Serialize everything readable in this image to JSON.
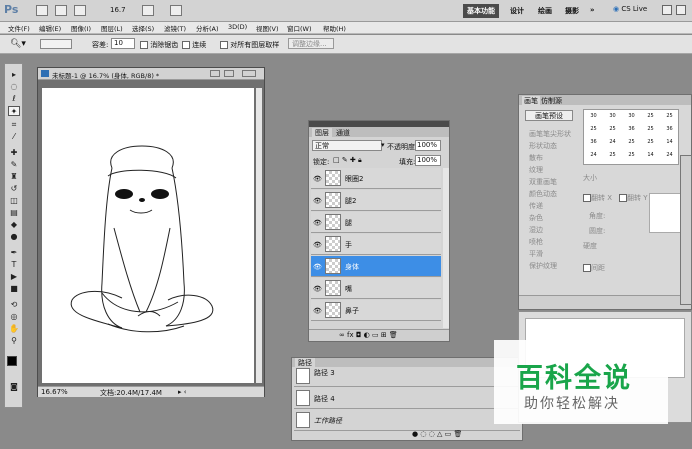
{
  "app": {
    "logo": "Ps",
    "zoom_value": "16.7",
    "workspaces": [
      "基本功能",
      "设计",
      "绘画",
      "摄影",
      "»"
    ],
    "cs_live": "CS Live"
  },
  "menu": [
    "文件(F)",
    "编辑(E)",
    "图像(I)",
    "图层(L)",
    "选择(S)",
    "滤镜(T)",
    "分析(A)",
    "3D(D)",
    "视图(V)",
    "窗口(W)",
    "帮助(H)"
  ],
  "options": {
    "tolerance_label": "容差:",
    "tolerance_value": "10",
    "antialias_label": "消除锯齿",
    "contiguous_label": "连续",
    "all_layers_label": "对所有图层取样",
    "refine_edge_label": "调整边缘..."
  },
  "document": {
    "title": "未标题-1 @ 16.7% (身体, RGB/8) *",
    "status_zoom": "16.67%",
    "status_doc": "文档:20.4M/17.4M"
  },
  "layers": {
    "tabs": [
      "图层",
      "通道"
    ],
    "blend_mode": "正常",
    "opacity_label": "不透明度:",
    "opacity_value": "100%",
    "lock_label": "锁定:",
    "fill_label": "填充:",
    "fill_value": "100%",
    "items": [
      {
        "name": "眼圈2"
      },
      {
        "name": "腿2"
      },
      {
        "name": "腿"
      },
      {
        "name": "手"
      },
      {
        "name": "身体"
      },
      {
        "name": "嘴"
      },
      {
        "name": "鼻子"
      }
    ]
  },
  "paths": {
    "tab": "路径",
    "items": [
      {
        "name": "路径 3"
      },
      {
        "name": "路径 4"
      },
      {
        "name": "工作路径"
      }
    ]
  },
  "brushes": {
    "tabs": [
      "画笔",
      "仿制源"
    ],
    "preset_button": "画笔预设",
    "options": [
      "画笔笔尖形状",
      "形状动态",
      "散布",
      "纹理",
      "双重画笔",
      "颜色动态",
      "传递",
      "杂色",
      "湿边",
      "喷枪",
      "平滑",
      "保护纹理"
    ],
    "sizes": [
      "30",
      "30",
      "30",
      "25",
      "25",
      "25",
      "25",
      "36",
      "25",
      "36",
      "36",
      "24",
      "25",
      "25",
      "14",
      "24",
      "25",
      "25",
      "14",
      "24"
    ],
    "size_label": "大小",
    "flipx_label": "翻转 X",
    "flipy_label": "翻转 Y",
    "angle_label": "角度:",
    "roundness_label": "圆度:",
    "hardness_label": "硬度",
    "spacing_label": "间距"
  },
  "watermark": {
    "main": "百科全说",
    "sub": "助你轻松解决"
  }
}
